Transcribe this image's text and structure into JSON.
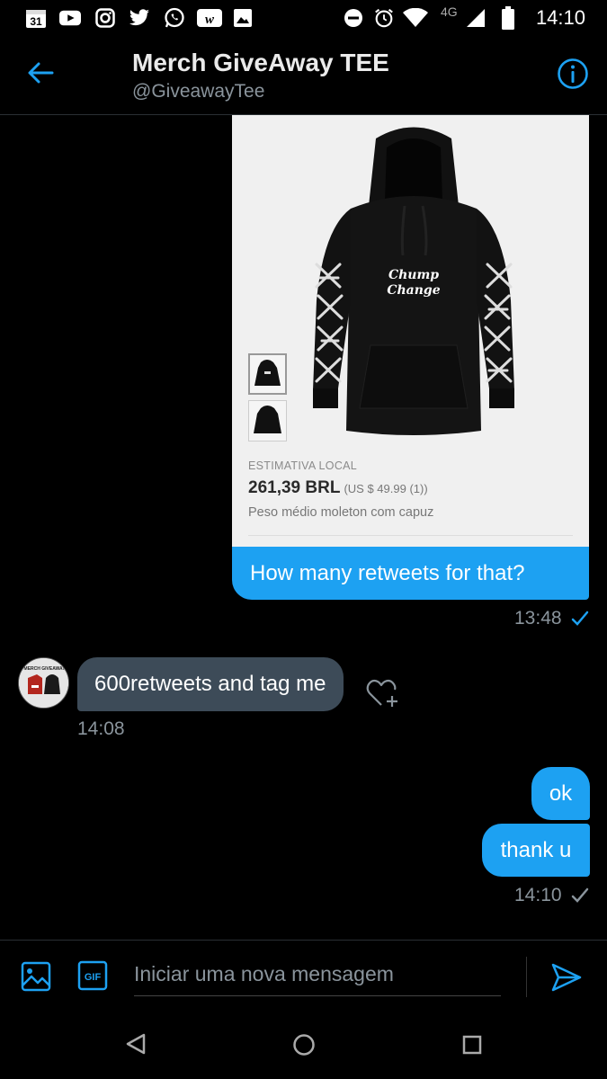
{
  "status_bar": {
    "calendar_day": "31",
    "network": "4G",
    "time": "14:10"
  },
  "header": {
    "title": "Merch GiveAway TEE",
    "handle": "@GiveawayTee"
  },
  "product_card": {
    "label": "ESTIMATIVA LOCAL",
    "price": "261,39 BRL",
    "price_usd": "(US $ 49.99 (1))",
    "description": "Peso médio moleton com capuz",
    "print_line1": "Chump",
    "print_line2": "Change"
  },
  "messages": [
    {
      "direction": "out",
      "text": "How many retweets for that?",
      "time": "13:48",
      "status": "read"
    },
    {
      "direction": "in",
      "text": "600retweets and tag me",
      "time": "14:08"
    },
    {
      "direction": "out",
      "text": "ok"
    },
    {
      "direction": "out",
      "text": "thank u",
      "time": "14:10",
      "status": "sent"
    }
  ],
  "avatar_caption": "MERCH GIVEAWAY",
  "composer": {
    "placeholder": "Iniciar uma nova mensagem",
    "gif_label": "GIF"
  },
  "colors": {
    "accent": "#1da1f2",
    "incoming_bubble": "#3d4b58",
    "muted_text": "#8a949c",
    "background": "#000000"
  },
  "icons": [
    "calendar-icon",
    "youtube-icon",
    "instagram-icon",
    "twitter-icon",
    "whatsapp-icon",
    "w-app-icon",
    "gallery-icon",
    "dnd-icon",
    "alarm-icon",
    "wifi-icon",
    "signal-icon",
    "battery-icon",
    "back-arrow-icon",
    "info-icon",
    "heart-plus-icon",
    "read-check-icon",
    "sent-check-icon",
    "image-icon",
    "gif-icon",
    "send-icon",
    "nav-back-icon",
    "nav-home-icon",
    "nav-recents-icon"
  ]
}
